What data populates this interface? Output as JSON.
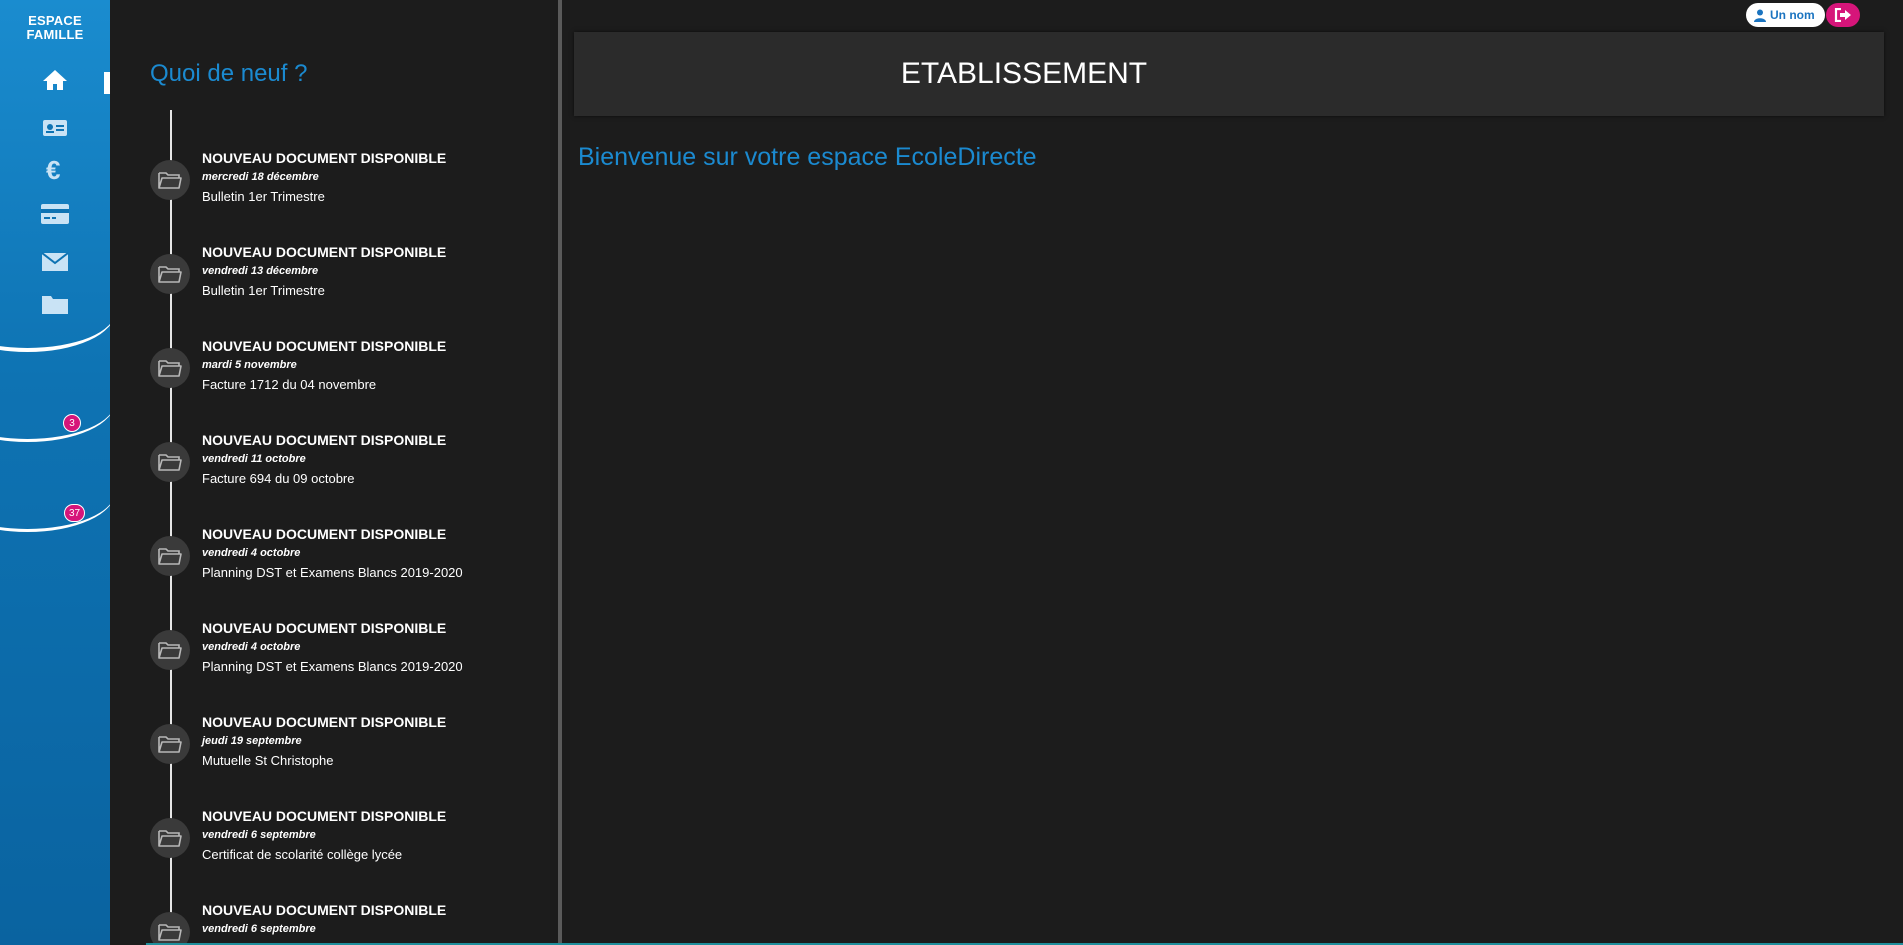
{
  "sidebar": {
    "brand_line1": "ESPACE",
    "brand_line2": "FAMILLE",
    "icons": [
      "home-icon",
      "id-card-icon",
      "euro-icon",
      "card-icon",
      "envelope-icon",
      "folder-icon"
    ],
    "badges": {
      "messages": "3",
      "documents": "37"
    }
  },
  "news": {
    "title": "Quoi de neuf ?",
    "items": [
      {
        "title": "NOUVEAU DOCUMENT DISPONIBLE",
        "date": "mercredi 18 décembre",
        "desc": "Bulletin 1er Trimestre"
      },
      {
        "title": "NOUVEAU DOCUMENT DISPONIBLE",
        "date": "vendredi 13 décembre",
        "desc": "Bulletin 1er Trimestre"
      },
      {
        "title": "NOUVEAU DOCUMENT DISPONIBLE",
        "date": "mardi 5 novembre",
        "desc": "Facture 1712 du 04 novembre"
      },
      {
        "title": "NOUVEAU DOCUMENT DISPONIBLE",
        "date": "vendredi 11 octobre",
        "desc": "Facture 694 du 09 octobre"
      },
      {
        "title": "NOUVEAU DOCUMENT DISPONIBLE",
        "date": "vendredi 4 octobre",
        "desc": "Planning DST et Examens Blancs 2019-2020"
      },
      {
        "title": "NOUVEAU DOCUMENT DISPONIBLE",
        "date": "vendredi 4 octobre",
        "desc": "Planning DST et Examens Blancs 2019-2020"
      },
      {
        "title": "NOUVEAU DOCUMENT DISPONIBLE",
        "date": "jeudi 19 septembre",
        "desc": "Mutuelle St Christophe"
      },
      {
        "title": "NOUVEAU DOCUMENT DISPONIBLE",
        "date": "vendredi 6 septembre",
        "desc": "Certificat de scolarité collège lycée"
      },
      {
        "title": "NOUVEAU DOCUMENT DISPONIBLE",
        "date": "vendredi 6 septembre",
        "desc": ""
      }
    ]
  },
  "main": {
    "etablissement": "ETABLISSEMENT",
    "welcome": "Bienvenue sur votre espace EcoleDirecte"
  },
  "header": {
    "user_name": "Un nom",
    "colors": {
      "accent": "#1b8ad0",
      "logout": "#d6157a"
    }
  }
}
